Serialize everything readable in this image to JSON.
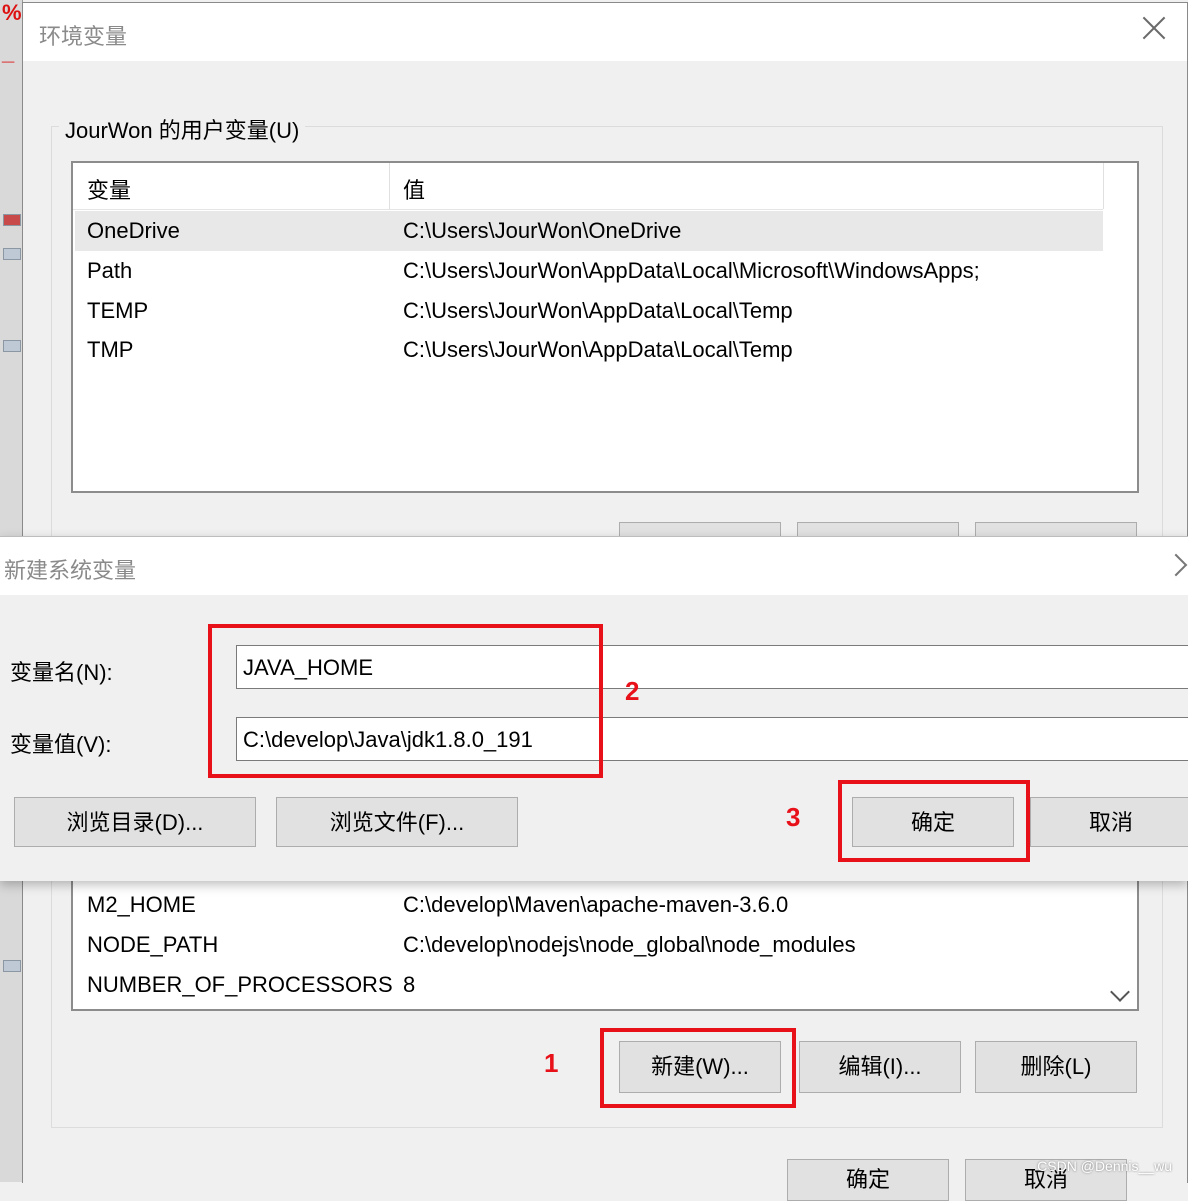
{
  "env_dialog": {
    "title": "环境变量",
    "user_group_label": "JourWon 的用户变量(U)",
    "columns": [
      "变量",
      "值"
    ],
    "user_vars": [
      {
        "name": "OneDrive",
        "value": "C:\\Users\\JourWon\\OneDrive"
      },
      {
        "name": "Path",
        "value": "C:\\Users\\JourWon\\AppData\\Local\\Microsoft\\WindowsApps;"
      },
      {
        "name": "TEMP",
        "value": "C:\\Users\\JourWon\\AppData\\Local\\Temp"
      },
      {
        "name": "TMP",
        "value": "C:\\Users\\JourWon\\AppData\\Local\\Temp"
      }
    ],
    "system_vars_visible": [
      {
        "name": "M2_HOME",
        "value": "C:\\develop\\Maven\\apache-maven-3.6.0"
      },
      {
        "name": "NODE_PATH",
        "value": "C:\\develop\\nodejs\\node_global\\node_modules"
      },
      {
        "name": "NUMBER_OF_PROCESSORS",
        "value": "8"
      }
    ],
    "system_buttons": {
      "new": "新建(W)...",
      "edit": "编辑(I)...",
      "delete": "删除(L)"
    },
    "bottom_buttons": {
      "ok_partial": "确定",
      "cancel_partial": "取消"
    }
  },
  "new_dialog": {
    "title": "新建系统变量",
    "name_label": "变量名(N):",
    "value_label": "变量值(V):",
    "name_value": "JAVA_HOME",
    "value_value": "C:\\develop\\Java\\jdk1.8.0_191",
    "browse_dir": "浏览目录(D)...",
    "browse_file": "浏览文件(F)...",
    "ok": "确定",
    "cancel": "取消"
  },
  "annotations": {
    "step1": "1",
    "step2": "2",
    "step3": "3"
  },
  "watermark": "CSDN @Dennis__wu",
  "colors": {
    "highlight": "#e8111a",
    "selected_row": "#e8e8e8"
  }
}
